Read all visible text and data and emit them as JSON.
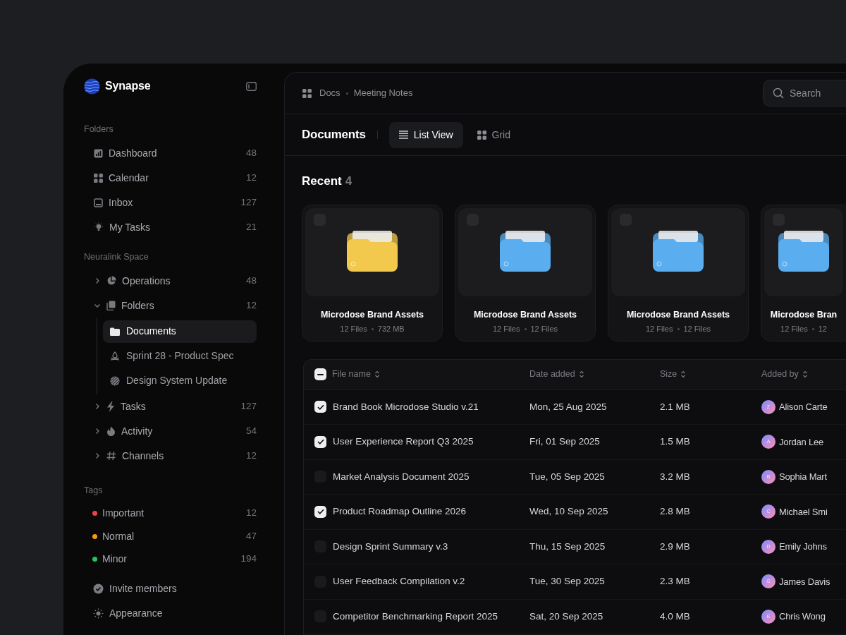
{
  "sidebar": {
    "brand": "Synapse",
    "folders": {
      "title": "Folders",
      "items": [
        {
          "label": "Dashboard",
          "count": "48"
        },
        {
          "label": "Calendar",
          "count": "12"
        },
        {
          "label": "Inbox",
          "count": "127"
        },
        {
          "label": "My Tasks",
          "count": "21"
        }
      ]
    },
    "space": {
      "title": "Neuralink Space",
      "items": [
        {
          "label": "Operations",
          "count": "48",
          "expanded": false
        },
        {
          "label": "Folders",
          "count": "12",
          "expanded": true,
          "children": [
            {
              "label": "Documents",
              "selected": true
            },
            {
              "label": "Sprint 28 - Product Spec",
              "selected": false
            },
            {
              "label": "Design System Update",
              "selected": false
            }
          ]
        },
        {
          "label": "Tasks",
          "count": "127",
          "expanded": false
        },
        {
          "label": "Activity",
          "count": "54",
          "expanded": false
        },
        {
          "label": "Channels",
          "count": "12",
          "expanded": false
        }
      ]
    },
    "tags": {
      "title": "Tags",
      "items": [
        {
          "label": "Important",
          "count": "12",
          "color": "#ef4444"
        },
        {
          "label": "Normal",
          "count": "47",
          "color": "#f59e0b"
        },
        {
          "label": "Minor",
          "count": "194",
          "color": "#22c55e"
        }
      ]
    },
    "footer": [
      {
        "label": "Invite members"
      },
      {
        "label": "Appearance"
      }
    ]
  },
  "breadcrumb": [
    "Docs",
    "Meeting Notes"
  ],
  "search": {
    "placeholder": "Search"
  },
  "page_title": "Documents",
  "views": [
    {
      "label": "List View",
      "selected": true
    },
    {
      "label": "Grid",
      "selected": false
    }
  ],
  "recent": {
    "title": "Recent",
    "count": "4",
    "cards": [
      {
        "title": "Microdose Brand Assets",
        "meta": [
          "12 Files",
          "732 MB"
        ],
        "color": "#f2c94c",
        "checked": false
      },
      {
        "title": "Microdose Brand Assets",
        "meta": [
          "12 Files",
          "12 Files"
        ],
        "color": "#5aaef0",
        "checked": false
      },
      {
        "title": "Microdose Brand Assets",
        "meta": [
          "12 Files",
          "12 Files"
        ],
        "color": "#5aaef0",
        "checked": false
      },
      {
        "title": "Microdose Bran",
        "meta": [
          "12 Files",
          "12"
        ],
        "color": "#5aaef0",
        "checked": false
      }
    ]
  },
  "table": {
    "select_all_indeterminate": true,
    "columns": [
      "File name",
      "Date added",
      "Size",
      "Added by"
    ],
    "rows": [
      {
        "name": "Brand Book Microdose Studio v.21",
        "date": "Mon, 25 Aug 2025",
        "size": "2.1 MB",
        "initial": "Z",
        "user": "Alison Carte",
        "checked": true
      },
      {
        "name": "User Experience Report Q3 2025",
        "date": "Fri, 01 Sep 2025",
        "size": "1.5 MB",
        "initial": "A",
        "user": "Jordan Lee",
        "checked": true
      },
      {
        "name": "Market Analysis Document 2025",
        "date": "Tue, 05 Sep 2025",
        "size": "3.2 MB",
        "initial": "B",
        "user": "Sophia Mart",
        "checked": false
      },
      {
        "name": "Product Roadmap Outline 2026",
        "date": "Wed, 10 Sep 2025",
        "size": "2.8 MB",
        "initial": "C",
        "user": "Michael Smi",
        "checked": true
      },
      {
        "name": "Design Sprint Summary v.3",
        "date": "Thu, 15 Sep 2025",
        "size": "2.9 MB",
        "initial": "D",
        "user": "Emily Johns",
        "checked": false
      },
      {
        "name": "User Feedback Compilation v.2",
        "date": "Tue, 30 Sep 2025",
        "size": "2.3 MB",
        "initial": "G",
        "user": "James Davis",
        "checked": false
      },
      {
        "name": "Competitor Benchmarking Report 2025",
        "date": "Sat, 20 Sep 2025",
        "size": "4.0 MB",
        "initial": "E",
        "user": "Chris Wong",
        "checked": false
      }
    ]
  }
}
